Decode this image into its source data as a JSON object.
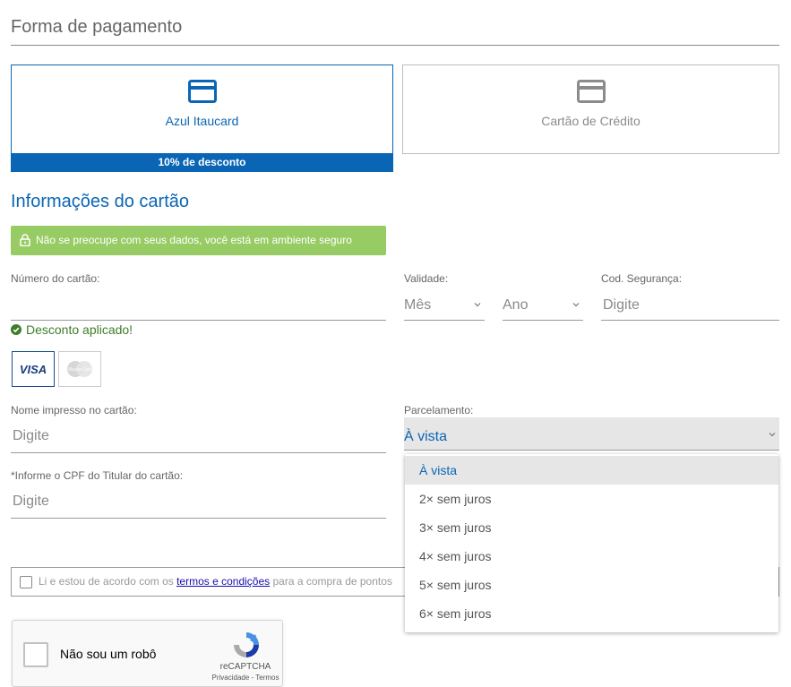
{
  "header": {
    "title": "Forma de pagamento"
  },
  "payment_methods": [
    {
      "label": "Azul Itaucard",
      "badge": "10% de desconto",
      "selected": true
    },
    {
      "label": "Cartão de Crédito",
      "selected": false
    }
  ],
  "card_info": {
    "title": "Informações do cartão",
    "secure_message": "Não se preocupe com seus dados, você está em ambiente seguro",
    "number_label": "Número do cartão:",
    "number_value": "",
    "validity_label": "Validade:",
    "month_placeholder": "Mês",
    "year_placeholder": "Ano",
    "cvv_label": "Cod. Segurança:",
    "cvv_placeholder": "Digite",
    "discount_applied": "Desconto aplicado!",
    "brands": [
      {
        "name": "VISA",
        "selected": true
      },
      {
        "name": "MasterCard",
        "selected": false
      }
    ],
    "name_label": "Nome impresso no cartão:",
    "name_placeholder": "Digite",
    "cpf_label": "*Informe o CPF do Titular do cartão:",
    "cpf_placeholder": "Digite"
  },
  "installments": {
    "label": "Parcelamento:",
    "selected": "À vista",
    "options": [
      "À vista",
      "2× sem juros",
      "3× sem juros",
      "4× sem juros",
      "5× sem juros",
      "6× sem juros"
    ]
  },
  "terms": {
    "prefix": "Li e estou de acordo com os ",
    "link": "termos e condições",
    "suffix": " para a compra de pontos"
  },
  "recaptcha": {
    "label": "Não sou um robô",
    "brand": "reCAPTCHA",
    "links": "Privacidade - Termos"
  },
  "colors": {
    "accent": "#0a66b5",
    "secure": "#97cc64",
    "success": "#3e7d2a"
  }
}
